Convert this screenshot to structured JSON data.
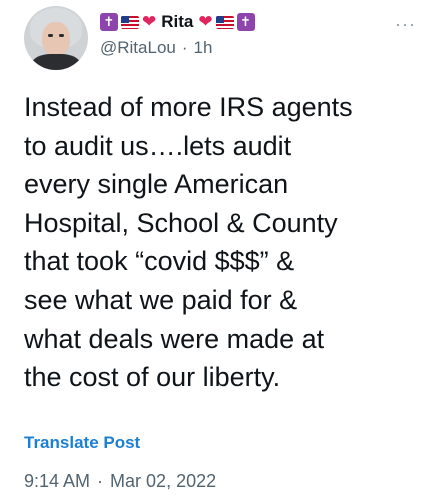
{
  "author": {
    "display_name": "Rita",
    "handle": "@RitaLou",
    "separator": "·",
    "relative_time": "1h",
    "name_emoji": [
      "latin-cross-emoji",
      "us-flag-emoji",
      "red-heart-emoji",
      "red-heart-emoji",
      "us-flag-emoji",
      "latin-cross-emoji"
    ]
  },
  "tweet": {
    "text": "Instead of more IRS agents\nto audit us….lets audit\nevery single American\nHospital, School & County\nthat took “covid $$$” &\nsee what we paid for &\nwhat deals were made at\nthe cost of our liberty."
  },
  "actions": {
    "more_icon": "more-options-icon",
    "more_glyph": "···",
    "translate_label": "Translate Post"
  },
  "meta": {
    "time": "9:14 AM",
    "separator": "·",
    "date": "Mar 02, 2022"
  },
  "colors": {
    "text": "#0f1419",
    "muted": "#536471",
    "link": "#1d7fd3",
    "heart": "#e0245e",
    "cross_badge": "#8e44ad"
  }
}
